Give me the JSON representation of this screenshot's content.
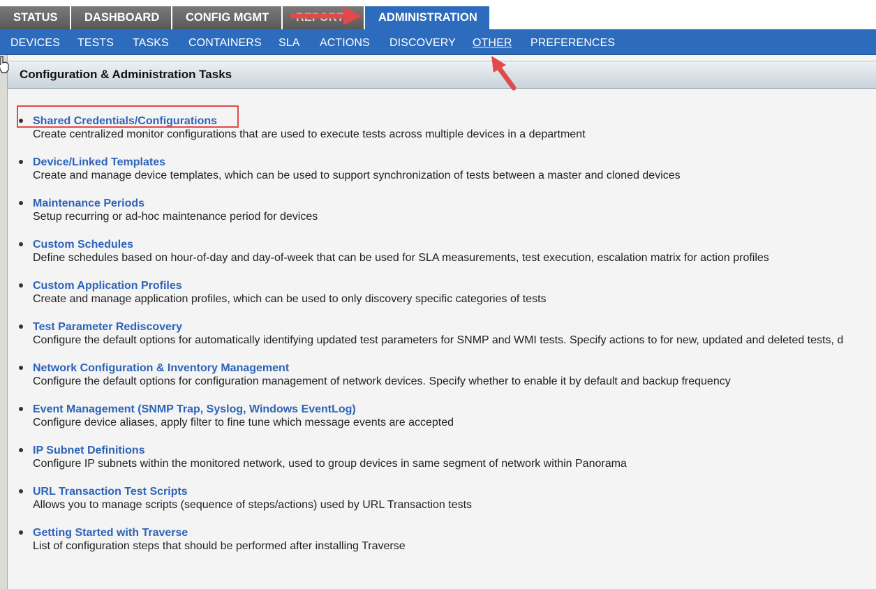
{
  "top_tabs": [
    {
      "label": "STATUS"
    },
    {
      "label": "DASHBOARD"
    },
    {
      "label": "CONFIG MGMT"
    },
    {
      "label": "REPORT"
    },
    {
      "label": "ADMINISTRATION",
      "active": true
    }
  ],
  "sub_nav": [
    {
      "label": "DEVICES"
    },
    {
      "label": "TESTS"
    },
    {
      "label": "TASKS"
    },
    {
      "label": "CONTAINERS"
    },
    {
      "label": "SLA"
    },
    {
      "label": "ACTIONS"
    },
    {
      "label": "DISCOVERY"
    },
    {
      "label": "OTHER",
      "active": true
    },
    {
      "label": "PREFERENCES"
    }
  ],
  "panel": {
    "title": "Configuration & Administration Tasks"
  },
  "tasks": [
    {
      "link": "Shared Credentials/Configurations",
      "desc": "Create centralized monitor configurations that are used to execute tests across multiple devices in a department",
      "highlighted": true
    },
    {
      "link": "Device/Linked Templates",
      "desc": "Create and manage device templates, which can be used to support synchronization of tests between a master and cloned devices"
    },
    {
      "link": "Maintenance Periods",
      "desc": "Setup recurring or ad-hoc maintenance period for devices"
    },
    {
      "link": "Custom Schedules",
      "desc": "Define schedules based on hour-of-day and day-of-week that can be used for SLA measurements, test execution, escalation matrix for action profiles"
    },
    {
      "link": "Custom Application Profiles",
      "desc": "Create and manage application profiles, which can be used to only discovery specific categories of tests"
    },
    {
      "link": "Test Parameter Rediscovery",
      "desc": "Configure the default options for automatically identifying updated test parameters for SNMP and WMI tests. Specify actions to for new, updated and deleted tests, d"
    },
    {
      "link": "Network Configuration & Inventory Management",
      "desc": "Configure the default options for configuration management of network devices. Specify whether to enable it by default and backup frequency"
    },
    {
      "link": "Event Management (SNMP Trap, Syslog, Windows EventLog)",
      "desc": "Configure device aliases, apply filter to fine tune which message events are accepted"
    },
    {
      "link": "IP Subnet Definitions",
      "desc": "Configure IP subnets within the monitored network, used to group devices in same segment of network within Panorama"
    },
    {
      "link": "URL Transaction Test Scripts",
      "desc": "Allows you to manage scripts (sequence of steps/actions) used by URL Transaction tests"
    },
    {
      "link": "Getting Started with Traverse",
      "desc": "List of configuration steps that should be performed after installing Traverse"
    }
  ],
  "colors": {
    "nav_blue": "#2d6bbd",
    "link_blue": "#2d63b8",
    "tab_gray": "#666666",
    "annotation_red": "#e24a4a"
  }
}
